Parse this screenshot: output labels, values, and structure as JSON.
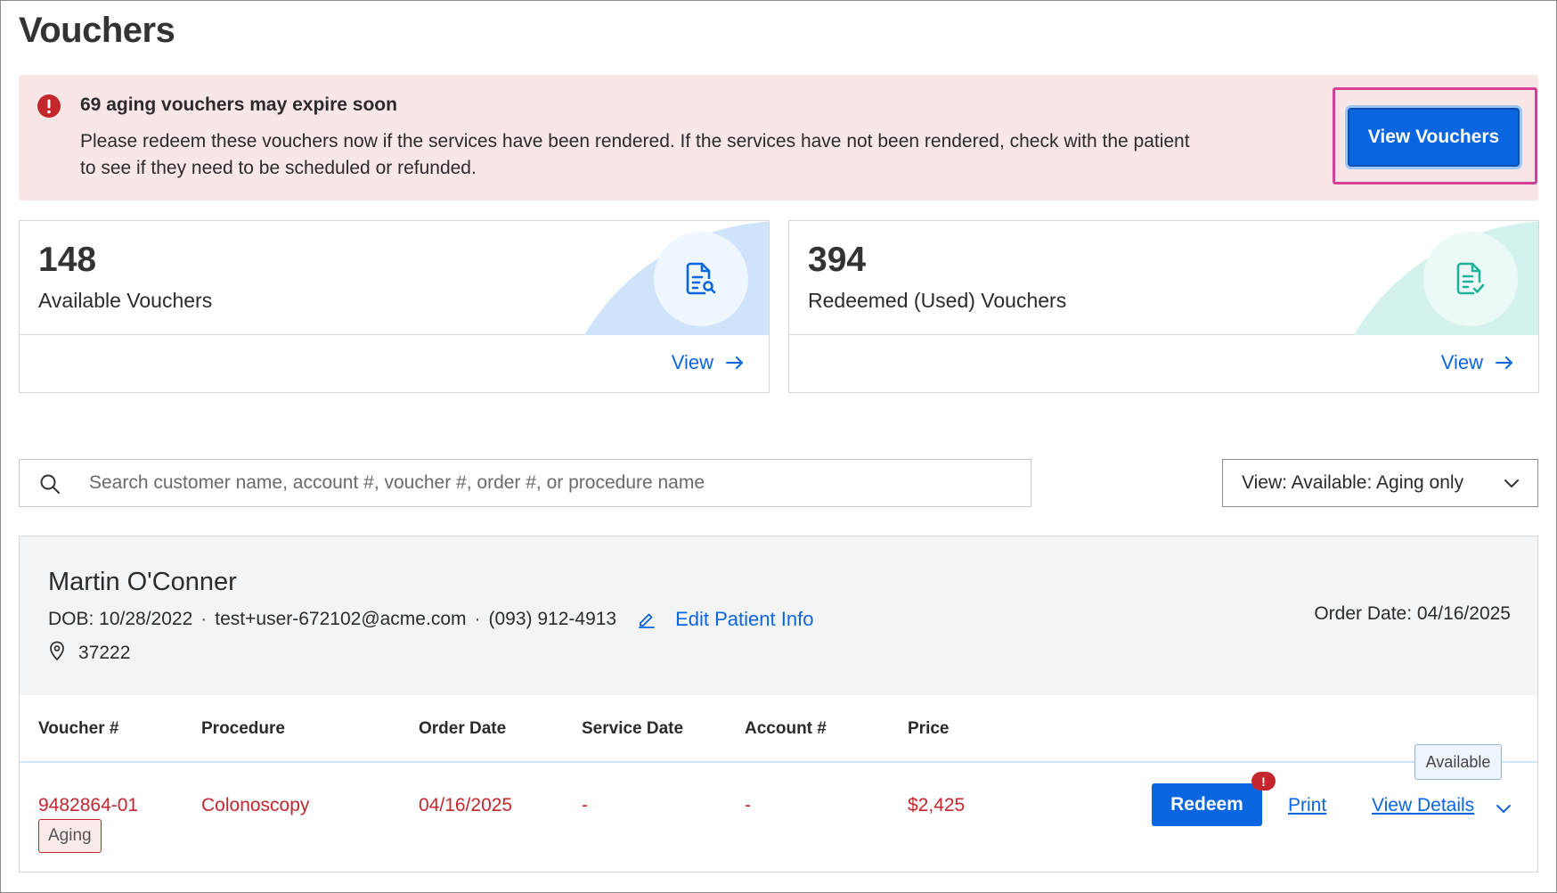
{
  "page": {
    "title": "Vouchers"
  },
  "alert": {
    "title": "69 aging vouchers may expire soon",
    "message": "Please redeem these vouchers now if the services have been rendered. If the services have not been rendered, check with the patient to see if they need to be scheduled or refunded.",
    "button_label": "View Vouchers",
    "icon": "error-icon",
    "color": "#f9e6e7"
  },
  "cards": [
    {
      "count": "148",
      "label": "Available Vouchers",
      "view_label": "View",
      "icon": "document-search-icon",
      "accent": "#cfe3fb"
    },
    {
      "count": "394",
      "label": "Redeemed (Used) Vouchers",
      "view_label": "View",
      "icon": "document-check-icon",
      "accent": "#d4f2ed"
    }
  ],
  "search": {
    "placeholder": "Search customer name, account #, voucher #, order #, or procedure name",
    "value": ""
  },
  "view_filter": {
    "selected": "View: Available: Aging only"
  },
  "patient": {
    "name": "Martin O'Conner",
    "dob": "DOB: 10/28/2022",
    "email": "test+user-672102@acme.com",
    "phone": "(093) 912-4913",
    "separator": "·",
    "edit_label": "Edit Patient Info",
    "zip": "37222",
    "order_date": "Order Date: 04/16/2025"
  },
  "table": {
    "columns": [
      "Voucher #",
      "Procedure",
      "Order Date",
      "Service Date",
      "Account #",
      "Price"
    ],
    "rows": [
      {
        "voucher": "9482864-01",
        "procedure": "Colonoscopy",
        "order_date": "04/16/2025",
        "service_date": "-",
        "account": "-",
        "price": "$2,425",
        "badge": "Aging",
        "status_tag": "Available",
        "redeem_label": "Redeem",
        "redeem_alert": "!",
        "print_label": "Print",
        "details_label": "View Details"
      }
    ]
  },
  "colors": {
    "primary": "#0a66e0",
    "danger": "#c4262e",
    "focus": "#d63f97"
  }
}
